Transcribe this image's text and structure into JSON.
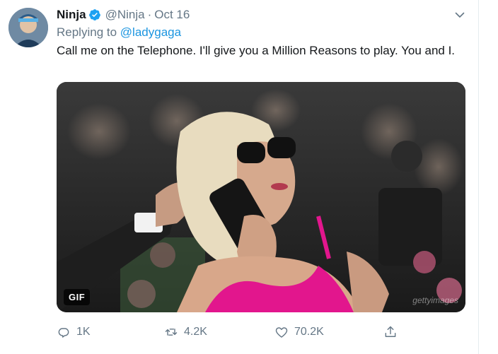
{
  "tweet": {
    "display_name": "Ninja",
    "handle": "@Ninja",
    "separator": "·",
    "timestamp": "Oct 16",
    "replying_prefix": "Replying to",
    "replying_to": "@ladygaga",
    "text": "Call me on the Telephone. I'll give you a Million Reasons to play. You and I.",
    "media": {
      "badge": "GIF",
      "watermark": "gettyimages"
    },
    "actions": {
      "reply_count": "1K",
      "retweet_count": "4.2K",
      "like_count": "70.2K"
    }
  },
  "icons": {
    "verified": "verified-badge-icon",
    "caret": "chevron-down-icon",
    "reply": "reply-bubble-icon",
    "retweet": "retweet-icon",
    "like": "heart-icon",
    "share": "share-icon"
  },
  "colors": {
    "accent": "#1b95e0",
    "verified": "#1da1f2",
    "secondary_text": "#657786",
    "primary_text": "#14171a",
    "media_accent_pink": "#e2168d"
  }
}
